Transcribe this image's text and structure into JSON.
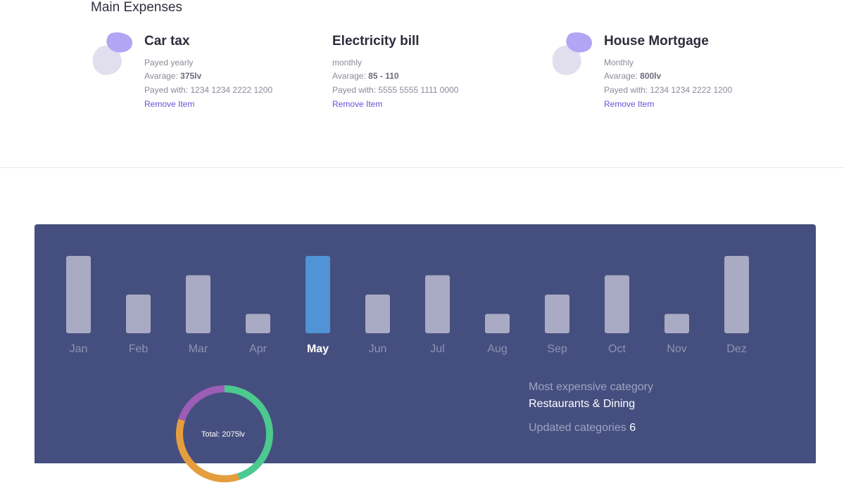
{
  "section_title": "Main Expenses",
  "expenses": [
    {
      "title": "Car tax",
      "frequency": "Payed yearly",
      "amount_label": "Avarage:",
      "amount": "375lv",
      "payment": "Payed with: 1234 1234 2222 1200",
      "remove": "Remove Item",
      "has_icon": true
    },
    {
      "title": "Electricity bill",
      "frequency": "monthly",
      "amount_label": "Avarage:",
      "amount_min": "85",
      "amount_sep": "-",
      "amount_max": "110",
      "payment": "Payed with: 5555 5555 1111 0000",
      "remove": "Remove Item",
      "has_icon": false
    },
    {
      "title": "House Mortgage",
      "frequency": "Monthly",
      "amount_label": "Avarage:",
      "amount": "800lv",
      "payment": "Payed with: 1234 1234 2222 1200",
      "remove": "Remove Item",
      "has_icon": true
    }
  ],
  "colors": {
    "panel_bg": "#454f7f",
    "bar": "#a9aac3",
    "bar_active": "#5094d6",
    "month_label": "#8e93b3",
    "month_active": "#ffffff",
    "blob_front": "#b2a5f3",
    "blob_back": "#e1dfee",
    "donut": [
      "#4bc98f",
      "#e59e3e",
      "#9b5db6"
    ]
  },
  "chart_data": {
    "type": "bar",
    "categories": [
      "Jan",
      "Feb",
      "Mar",
      "Apr",
      "May",
      "Jun",
      "Jul",
      "Aug",
      "Sep",
      "Oct",
      "Nov",
      "Dez"
    ],
    "values": [
      4,
      2,
      3,
      1,
      4,
      2,
      3,
      1,
      2,
      3,
      1,
      4
    ],
    "active": "May",
    "ylim": [
      0,
      4
    ],
    "grid": false
  },
  "donut": {
    "total_label": "Total: 2075lv",
    "segments": [
      {
        "value": 45,
        "color": "#4bc98f"
      },
      {
        "value": 35,
        "color": "#e59e3e"
      },
      {
        "value": 20,
        "color": "#9b5db6"
      }
    ]
  },
  "stats": {
    "most_expensive_label": "Most expensive category",
    "most_expensive_value": "Restaurants & Dining",
    "updated_label": "Updated categories",
    "updated_value": "6"
  }
}
